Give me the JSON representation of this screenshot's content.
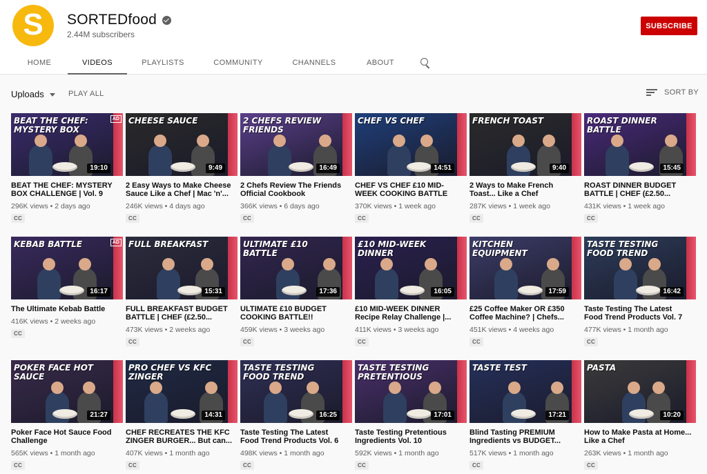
{
  "channel": {
    "avatar_letter": "S",
    "name": "SORTEDfood",
    "subscribers": "2.44M subscribers",
    "subscribe_label": "SUBSCRIBE",
    "brand_color": "#f7b90e"
  },
  "tabs": [
    "HOME",
    "VIDEOS",
    "PLAYLISTS",
    "COMMUNITY",
    "CHANNELS",
    "ABOUT"
  ],
  "toolbar": {
    "uploads_label": "Uploads",
    "play_all_label": "PLAY ALL",
    "sort_label": "SORT BY"
  },
  "videos": [
    {
      "thumb_text": "BEAT THE CHEF: MYSTERY BOX",
      "ad": "AD",
      "duration": "19:10",
      "title": "BEAT THE CHEF: MYSTERY BOX CHALLENGE | Vol. 9",
      "views": "296K views",
      "age": "2 days ago",
      "cc": "CC",
      "bg": "#3b2c6e"
    },
    {
      "thumb_text": "CHEESE SAUCE",
      "duration": "9:49",
      "title": "2 Easy Ways to Make Cheese Sauce Like a Chef | Mac 'n'...",
      "views": "246K views",
      "age": "4 days ago",
      "cc": "CC",
      "bg": "#2a2a2a"
    },
    {
      "thumb_text": "2 Chefs Review FRIENDS",
      "duration": "16:49",
      "title": "2 Chefs Review The Friends Official Cookbook",
      "views": "366K views",
      "age": "6 days ago",
      "cc": "CC",
      "bg": "#5a3f8a"
    },
    {
      "thumb_text": "CHEF vs CHEF",
      "duration": "14:51",
      "title": "CHEF VS CHEF £10 MID-WEEK COOKING BATTLE",
      "views": "370K views",
      "age": "1 week ago",
      "cc": "CC",
      "bg": "#1f3f7a"
    },
    {
      "thumb_text": "FRENCH TOAST",
      "duration": "9:40",
      "title": "2 Ways to Make French Toast... Like a Chef",
      "views": "287K views",
      "age": "1 week ago",
      "cc": "CC",
      "bg": "#2b2b2b"
    },
    {
      "thumb_text": "ROAST DINNER BATTLE",
      "duration": "15:45",
      "title": "ROAST DINNER BUDGET BATTLE | CHEF (£2.50...",
      "views": "431K views",
      "age": "1 week ago",
      "cc": "CC",
      "bg": "#4a2a7a"
    },
    {
      "thumb_text": "KEBAB BATTLE",
      "ad": "AD",
      "duration": "16:17",
      "title": "The Ultimate Kebab Battle",
      "views": "416K views",
      "age": "2 weeks ago",
      "cc": "CC",
      "bg": "#3a2a5e"
    },
    {
      "thumb_text": "FULL BREAKFAST",
      "duration": "15:31",
      "title": "FULL BREAKFAST BUDGET BATTLE | CHEF (£2.50...",
      "views": "473K views",
      "age": "2 weeks ago",
      "cc": "CC",
      "bg": "#2c2c3e"
    },
    {
      "thumb_text": "ULTIMATE £10 BATTLE",
      "duration": "17:36",
      "title": "ULTIMATE £10 BUDGET COOKING BATTLE!!",
      "views": "459K views",
      "age": "3 weeks ago",
      "cc": "CC",
      "bg": "#332650"
    },
    {
      "thumb_text": "£10 MID-WEEK DINNER",
      "duration": "16:05",
      "title": "£10 MID-WEEK DINNER Recipe Relay Challenge |...",
      "views": "411K views",
      "age": "3 weeks ago",
      "cc": "CC",
      "bg": "#2b2050"
    },
    {
      "thumb_text": "KITCHEN EQUIPMENT",
      "duration": "17:59",
      "title": "£25 Coffee Maker OR £350 Coffee Machine? | Chefs...",
      "views": "451K views",
      "age": "4 weeks ago",
      "cc": "CC",
      "bg": "#3d3d6a"
    },
    {
      "thumb_text": "TASTE TESTING Food Trend",
      "duration": "16:42",
      "title": "Taste Testing The Latest Food Trend Products Vol. 7",
      "views": "477K views",
      "age": "1 month ago",
      "cc": "CC",
      "bg": "#2d3d5a"
    },
    {
      "thumb_text": "POKER FACE hot sauce",
      "duration": "21:27",
      "title": "Poker Face Hot Sauce Food Challenge",
      "views": "565K views",
      "age": "1 month ago",
      "cc": "CC",
      "bg": "#3a2a4a"
    },
    {
      "thumb_text": "PRO CHEF vs KFC ZINGER",
      "duration": "14:31",
      "title": "CHEF RECREATES THE KFC ZINGER BURGER... But can...",
      "views": "407K views",
      "age": "1 month ago",
      "cc": "CC",
      "bg": "#1f2a44"
    },
    {
      "thumb_text": "TASTE TESTING Food Trend",
      "duration": "16:25",
      "title": "Taste Testing The Latest Food Trend Products Vol. 6",
      "views": "498K views",
      "age": "1 month ago",
      "cc": "CC",
      "bg": "#2f2f55"
    },
    {
      "thumb_text": "TASTE TESTING Pretentious",
      "duration": "17:01",
      "title": "Taste Testing Pretentious Ingredients Vol. 10",
      "views": "592K views",
      "age": "1 month ago",
      "cc": "CC",
      "bg": "#4a2f6a"
    },
    {
      "thumb_text": "TASTE TEST",
      "duration": "17:21",
      "title": "Blind Tasting PREMIUM Ingredients vs BUDGET...",
      "views": "517K views",
      "age": "1 month ago",
      "cc": "CC",
      "bg": "#25305a"
    },
    {
      "thumb_text": "PASTA",
      "duration": "10:20",
      "title": "How to Make Pasta at Home... Like a Chef",
      "views": "263K views",
      "age": "1 month ago",
      "cc": "CC",
      "bg": "#3b3b3b"
    }
  ]
}
